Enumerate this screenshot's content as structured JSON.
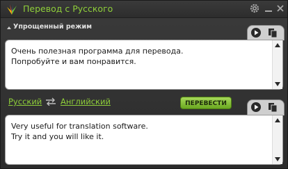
{
  "window": {
    "title": "Перевод с Русского"
  },
  "mode": {
    "label": "Упрощенный режим"
  },
  "source": {
    "text_line1": "Очень полезная программа для перевода.",
    "text_line2": "Попробуйте и вам понравится."
  },
  "languages": {
    "from": "Русский",
    "to": "Английский",
    "translate_label": "ПЕРЕВЕСТИ"
  },
  "result": {
    "text_line1": "Very useful for translation software.",
    "text_line2": "Try it and you will like it."
  },
  "icons": {
    "logo": "app-logo-icon",
    "settings": "gear-icon",
    "minimize": "minimize-icon",
    "close": "close-icon",
    "play": "play-icon",
    "copy": "copy-icon",
    "swap": "swap-arrows-icon"
  },
  "colors": {
    "accent": "#8fcf3a",
    "button": "#7ab82d",
    "window_bg": "#333333",
    "textbox_bg": "#ffffff"
  }
}
